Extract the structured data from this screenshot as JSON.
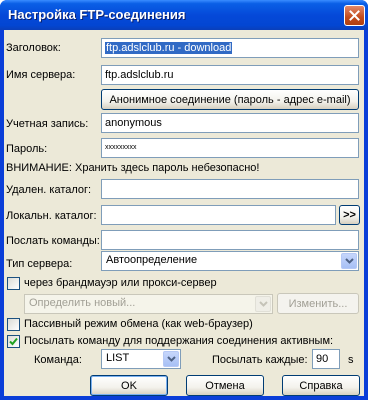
{
  "window": {
    "title": "Настройка FTP-соединения"
  },
  "fields": {
    "header": {
      "label": "Заголовок:",
      "value": "ftp.adslclub.ru - download"
    },
    "server": {
      "label": "Имя сервера:",
      "value": "ftp.adslclub.ru"
    },
    "anonymous_button": "Анонимное соединение (пароль - адрес e-mail)",
    "account": {
      "label": "Учетная запись:",
      "value": "anonymous"
    },
    "password": {
      "label": "Пароль:",
      "value": "xxxxxxxxx"
    },
    "warning": "ВНИМАНИЕ: Хранить здесь пароль небезопасно!",
    "remote_dir": {
      "label": "Удален. каталог:",
      "value": ""
    },
    "local_dir": {
      "label": "Локальн. каталог:",
      "value": "",
      "browse": ">>"
    },
    "send_commands": {
      "label": "Послать команды:",
      "value": ""
    },
    "server_type": {
      "label": "Тип сервера:",
      "value": "Автоопределение"
    }
  },
  "proxy": {
    "checkbox_label": "через брандмауэр или прокси-сервер",
    "checked": false,
    "select_value": "Определить новый...",
    "change_button": "Изменить..."
  },
  "passive": {
    "label": "Пассивный режим обмена (как web-браузер)",
    "checked": false
  },
  "keepalive": {
    "label": "Посылать команду для поддержания соединения активным:",
    "checked": true,
    "command_label": "Команда:",
    "command_value": "LIST",
    "interval_label": "Посылать каждые:",
    "interval_value": "90",
    "interval_unit": "s"
  },
  "buttons": {
    "ok": "OK",
    "cancel": "Отмена",
    "help": "Справка"
  }
}
